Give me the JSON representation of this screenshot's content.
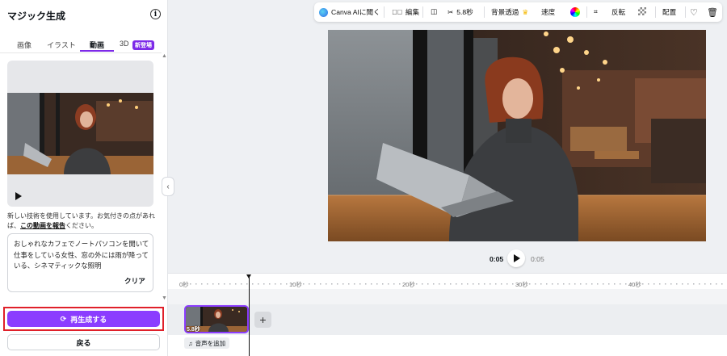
{
  "panel": {
    "title": "マジック生成",
    "tabs": {
      "image": "画像",
      "illust": "イラスト",
      "video": "動画",
      "three_d": "3D",
      "new_badge": "新登場"
    },
    "notice_text": "新しい技術を使用しています。お気付きの点があれば、",
    "notice_link": "この動画を報告",
    "notice_suffix": "ください。",
    "prompt": "おしゃれなカフェでノートパソコンを開いて仕事をしている女性、窓の外には雨が降っている、シネマティックな照明",
    "clear_label": "クリア",
    "regenerate_label": "再生成する",
    "back_label": "戻る"
  },
  "toolbar": {
    "open_canva_ai": "Canva AIに聞く",
    "edit": "編集",
    "duration": "5.8秒",
    "bg_remove": "背景透過",
    "speed": "速度",
    "flip": "反転",
    "arrange": "配置"
  },
  "player": {
    "current": "0:05",
    "total": "0:05"
  },
  "timeline": {
    "ticks": [
      "0秒",
      "10秒",
      "20秒",
      "30秒",
      "40秒"
    ],
    "clip_duration": "5.8秒",
    "add_audio": "音声を追加"
  },
  "colors": {
    "accent": "#8b3dff",
    "highlight": "#e0202a"
  }
}
